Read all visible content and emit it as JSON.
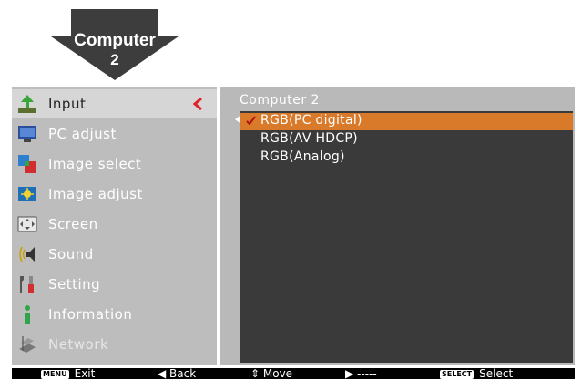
{
  "callout": {
    "line1": "Computer",
    "line2": "2"
  },
  "menu": {
    "items": [
      {
        "label": "Input",
        "icon": "input-icon"
      },
      {
        "label": "PC adjust",
        "icon": "monitor-icon"
      },
      {
        "label": "Image select",
        "icon": "image-select-icon"
      },
      {
        "label": "Image adjust",
        "icon": "image-adjust-icon"
      },
      {
        "label": "Screen",
        "icon": "screen-icon"
      },
      {
        "label": "Sound",
        "icon": "speaker-icon"
      },
      {
        "label": "Setting",
        "icon": "tools-icon"
      },
      {
        "label": "Information",
        "icon": "information-icon"
      },
      {
        "label": "Network",
        "icon": "network-icon"
      }
    ],
    "active_index": 0,
    "disabled_index": 8
  },
  "submenu": {
    "title": "Computer 2",
    "options": [
      "RGB(PC digital)",
      "RGB(AV HDCP)",
      "RGB(Analog)"
    ],
    "selected_index": 0,
    "accent_color": "#d97a2a"
  },
  "bottombar": {
    "exit_key": "MENU",
    "exit_label": "Exit",
    "back_label": "Back",
    "move_label": "Move",
    "next_label": "-----",
    "select_key": "SELECT",
    "select_label": "Select"
  }
}
